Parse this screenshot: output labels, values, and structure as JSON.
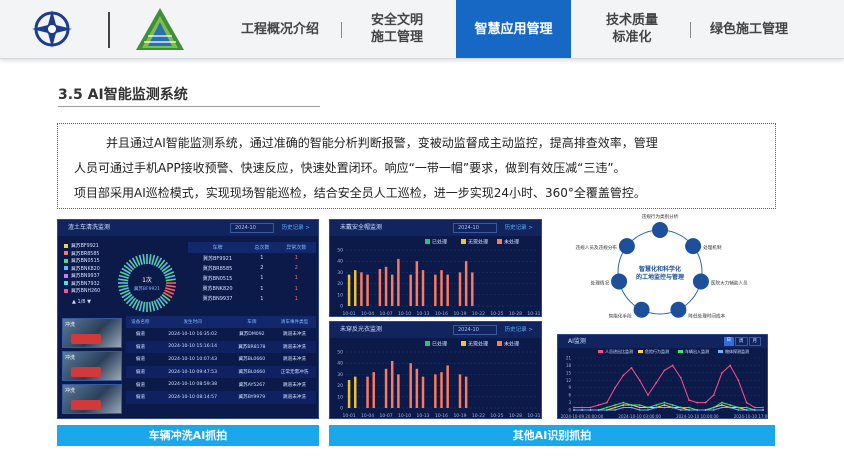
{
  "nav": {
    "items": [
      {
        "label": "工程概况介绍"
      },
      {
        "label": "安全文明",
        "label2": "施工管理"
      },
      {
        "label": "智慧应用管理"
      },
      {
        "label": "技术质量",
        "label2": "标准化"
      },
      {
        "label": "绿色施工管理"
      }
    ],
    "active_index": 2
  },
  "section": {
    "title": "3.5 AI智能监测系统"
  },
  "intro": {
    "lines": [
      "并且通过AI智能监测系统，通过准确的智能分析判断报警，变被动监督成主动监控，提高排查效率，管理",
      "人员可通过手机APP接收预警、快速反应，快速处置闭环。响应“一带一帽”要求，做到有效压减“三违”。",
      "项目部采用AI巡检模式，实现现场智能巡检，结合安全员人工巡检，进一步实现24小时、360°全覆盖管控。"
    ]
  },
  "wash_panel": {
    "title": "渣土车清洗监测",
    "date": "2024-10",
    "history": "历史记录 >",
    "plates": [
      "冀苏BF9921",
      "冀苏BR8585",
      "冀苏BN0515",
      "冀苏BNK820",
      "冀苏BN9937",
      "冀苏BN7932",
      "冀苏BNH260"
    ],
    "donut_center": "1次",
    "donut_sub": "冀苏BF9921",
    "pager": "1/8",
    "table1_headers": [
      "车牌",
      "总次数",
      "异常次数"
    ],
    "table1_rows": [
      [
        "冀苏BF9921",
        "1",
        "1"
      ],
      [
        "冀苏BR8585",
        "2",
        "2"
      ],
      [
        "冀苏BN0515",
        "1",
        "1"
      ],
      [
        "冀苏BNK820",
        "1",
        "1"
      ],
      [
        "冀苏BN9937",
        "1",
        "1"
      ]
    ],
    "thumbs": [
      "冲洗",
      "冲洗",
      "冲洗"
    ],
    "table2_headers": [
      "设备名称",
      "发生时间",
      "车牌",
      "清车事件类型"
    ],
    "table2_rows": [
      [
        "偏道",
        "2024-10-10 16:35:02",
        "冀苏DM092",
        "跳道未冲洗"
      ],
      [
        "偏道",
        "2024-10-10 15:16:14",
        "冀苏BR8178",
        "跳道未冲洗"
      ],
      [
        "偏道",
        "2024-10-10 10:07:43",
        "冀苏BL0660",
        "跳道未冲洗"
      ],
      [
        "偏道",
        "2024-10-10 09:47:53",
        "冀苏BL0660",
        "正常无需冲洗"
      ],
      [
        "偏道",
        "2024-10-10 08:59:38",
        "冀苏AY5267",
        "跳道未冲洗"
      ],
      [
        "偏道",
        "2024-10-10 08:14:57",
        "冀苏BY9979",
        "跳道未冲洗"
      ]
    ]
  },
  "helmet_panel": {
    "title": "未戴安全帽监测",
    "date": "2024-10",
    "history": "历史记录 >",
    "legend": [
      "已处理",
      "无需处理",
      "未处理"
    ],
    "legend_colors": [
      "#26c281",
      "#f2c230",
      "#ff7a5c"
    ],
    "chart_data": {
      "type": "bar",
      "categories": [
        "10-01",
        "10-02",
        "10-03",
        "10-04",
        "10-05",
        "10-06",
        "10-07",
        "10-08",
        "10-09",
        "10-10",
        "10-11",
        "10-12",
        "10-13",
        "10-14",
        "10-15",
        "10-16",
        "10-17",
        "10-18",
        "10-19",
        "10-20",
        "10-21",
        "10-22",
        "10-23",
        "10-24",
        "10-25",
        "10-26",
        "10-27",
        "10-28",
        "10-29",
        "10-30",
        "10-31"
      ],
      "x_tick_labels": [
        "10-01",
        "10-04",
        "10-07",
        "10-10",
        "10-13",
        "10-16",
        "10-19",
        "10-22",
        "10-25",
        "10-28",
        "10-31"
      ],
      "y_ticks": [
        "0",
        "10",
        "20",
        "30",
        "40",
        "50"
      ],
      "ylim": [
        0,
        50
      ],
      "series": [
        {
          "name": "未处理",
          "values": [
            0,
            0,
            30,
            28,
            0,
            33,
            35,
            28,
            42,
            0,
            28,
            40,
            32,
            0,
            28,
            32,
            28,
            0,
            30,
            40,
            30,
            0,
            0,
            0,
            0,
            0,
            0,
            0,
            0,
            0,
            0
          ]
        },
        {
          "name": "无需处理",
          "values": [
            28,
            32,
            0,
            0,
            0,
            0,
            0,
            0,
            0,
            0,
            0,
            0,
            0,
            0,
            0,
            0,
            0,
            0,
            0,
            0,
            0,
            0,
            0,
            0,
            0,
            0,
            0,
            0,
            0,
            0,
            0
          ]
        }
      ]
    }
  },
  "vest_panel": {
    "title": "未穿反光衣监测",
    "date": "2024-10",
    "history": "历史记录 >",
    "legend": [
      "已处理",
      "无需处理",
      "未处理"
    ],
    "legend_colors": [
      "#26c281",
      "#f2c230",
      "#ff7a5c"
    ],
    "chart_data": {
      "type": "bar",
      "categories": [
        "10-01",
        "10-02",
        "10-03",
        "10-04",
        "10-05",
        "10-06",
        "10-07",
        "10-08",
        "10-09",
        "10-10",
        "10-11",
        "10-12",
        "10-13",
        "10-14",
        "10-15",
        "10-16",
        "10-17",
        "10-18",
        "10-19",
        "10-20",
        "10-21",
        "10-22",
        "10-23",
        "10-24",
        "10-25",
        "10-26",
        "10-27",
        "10-28",
        "10-29",
        "10-30",
        "10-31"
      ],
      "x_tick_labels": [
        "10-01",
        "10-04",
        "10-07",
        "10-10",
        "10-13",
        "10-16",
        "10-19",
        "10-22",
        "10-25",
        "10-28",
        "10-31"
      ],
      "y_ticks": [
        "0",
        "10",
        "20",
        "30",
        "40",
        "50"
      ],
      "ylim": [
        0,
        50
      ],
      "series": [
        {
          "name": "未处理",
          "values": [
            0,
            0,
            0,
            28,
            32,
            0,
            35,
            42,
            30,
            0,
            40,
            35,
            28,
            0,
            30,
            32,
            38,
            0,
            30,
            28,
            0,
            0,
            0,
            0,
            0,
            0,
            0,
            0,
            0,
            0,
            0
          ]
        },
        {
          "name": "无需处理",
          "values": [
            25,
            28,
            0,
            0,
            0,
            0,
            0,
            0,
            0,
            0,
            0,
            0,
            0,
            0,
            0,
            0,
            0,
            0,
            0,
            0,
            0,
            0,
            0,
            0,
            0,
            0,
            0,
            0,
            0,
            0,
            0
          ]
        }
      ]
    }
  },
  "ai_panel": {
    "title": "AI监测",
    "tabs": [
      "日",
      "周",
      "月"
    ],
    "legend": [
      "人员进出比监测",
      "危险行为监测",
      "车辆出入监测",
      "物体探测监测"
    ],
    "legend_colors": [
      "#ff4f8b",
      "#ffd24f",
      "#42e27a",
      "#6fb2ff"
    ],
    "y_ticks": [
      "0",
      "3",
      "6",
      "9",
      "12",
      "15",
      "18",
      "21"
    ],
    "x_labels": [
      "2024-10-09 20:00:00",
      "2024-10-10 03:00:00",
      "2024-10-10 10:00:00",
      "2024-10-10 17:00:00"
    ],
    "chart_data": {
      "type": "line",
      "ylim": [
        0,
        21
      ],
      "series": [
        {
          "name": "人员进出比监测",
          "values": [
            1,
            1,
            1,
            2,
            3,
            9,
            14,
            17,
            12,
            6,
            11,
            16,
            18,
            13,
            4,
            3,
            3,
            6,
            15,
            18,
            12,
            3,
            1,
            1
          ]
        },
        {
          "name": "危险行为监测",
          "values": [
            0,
            0,
            0,
            0,
            0,
            1,
            2,
            2,
            1,
            1,
            1,
            2,
            1,
            1,
            0,
            0,
            0,
            1,
            2,
            1,
            1,
            0,
            0,
            0
          ]
        },
        {
          "name": "车辆出入监测",
          "values": [
            0,
            0,
            0,
            0,
            1,
            2,
            3,
            2,
            2,
            1,
            2,
            3,
            2,
            1,
            1,
            0,
            0,
            1,
            3,
            2,
            1,
            1,
            0,
            0
          ]
        },
        {
          "name": "物体探测监测",
          "values": [
            0,
            0,
            0,
            0,
            0,
            0,
            1,
            1,
            0,
            0,
            1,
            1,
            1,
            0,
            0,
            0,
            0,
            0,
            1,
            1,
            0,
            0,
            0,
            0
          ]
        }
      ]
    }
  },
  "diagram": {
    "center": "智慧化和科学化的工地监控与管理",
    "nodes": [
      "违规行为类别分析",
      "处理机制",
      "医院大力辅助人员",
      "降低处理时间成本",
      "智能化手段",
      "处理情况",
      "违规人员及违规分布"
    ]
  },
  "captions": {
    "left": "车辆冲洗AI抓拍",
    "right": "其他AI识别抓拍"
  }
}
